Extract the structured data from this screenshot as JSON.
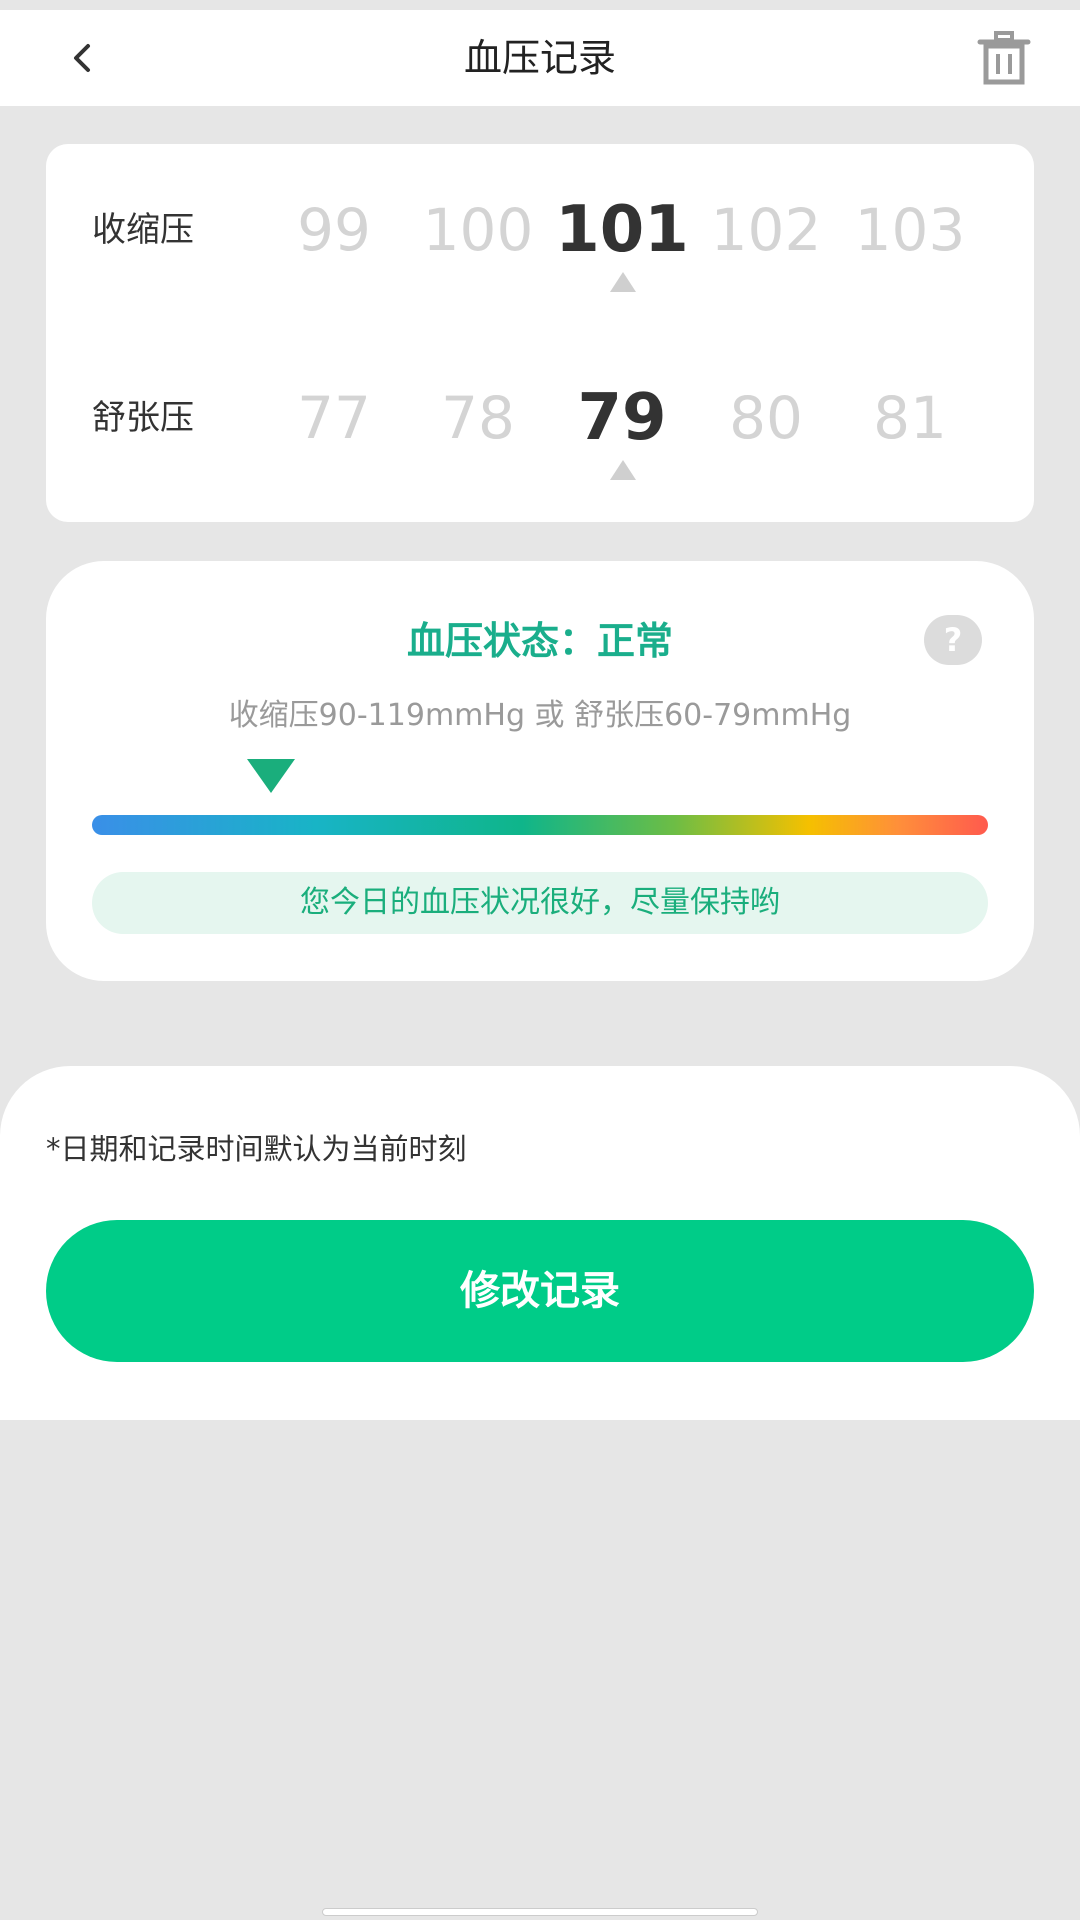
{
  "header": {
    "title": "血压记录",
    "back_icon": "chevron-left-icon",
    "delete_icon": "trash-icon"
  },
  "picker": {
    "systolic": {
      "label": "收缩压",
      "options": [
        "99",
        "100",
        "101",
        "102",
        "103"
      ],
      "selected": "101"
    },
    "diastolic": {
      "label": "舒张压",
      "options": [
        "77",
        "78",
        "79",
        "80",
        "81"
      ],
      "selected": "79"
    }
  },
  "status": {
    "title": "血压状态：正常",
    "help_label": "?",
    "range_text": "收缩压90-119mmHg 或 舒张压60-79mmHg",
    "marker_position": 0.2,
    "message": "您今日的血压状况很好，尽量保持哟",
    "accent_color": "#1aae7c"
  },
  "bottom": {
    "note": "*日期和记录时间默认为当前时刻",
    "submit_label": "修改记录",
    "submit_color": "#00cc88"
  }
}
